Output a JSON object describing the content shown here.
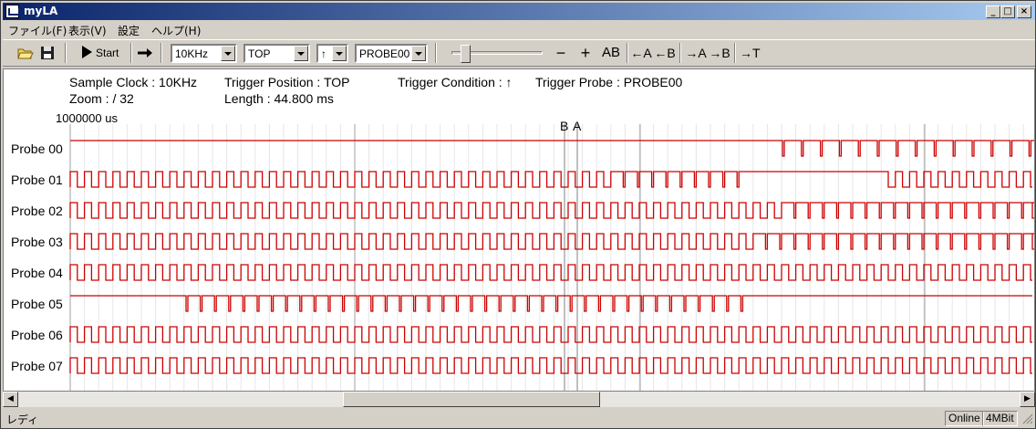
{
  "window": {
    "title": "myLA"
  },
  "menu": [
    "ファイル(F)",
    "表示(V)",
    "設定",
    "ヘルプ(H)"
  ],
  "toolbar": {
    "start_label": "Start",
    "clock_select": "10KHz",
    "position_select": "TOP",
    "condition_select": "↑",
    "probe_select": "PROBE00",
    "minus": "−",
    "plus": "+",
    "ab": "AB",
    "left_a": "←A",
    "left_b": "←B",
    "right_a": "→A",
    "right_b": "→B",
    "right_t": "→T"
  },
  "info": {
    "sample_clock": "Sample Clock : 10KHz",
    "zoom": "Zoom : /  32",
    "trigger_position": "Trigger Position : TOP",
    "length": "Length : 44.800 ms",
    "trigger_condition": "Trigger Condition :  ↑",
    "trigger_probe": "Trigger Probe : PROBE00"
  },
  "scale_label": "1000000 us",
  "cursor_labels": {
    "b": "B",
    "a": "A"
  },
  "probes": [
    "Probe 00",
    "Probe 01",
    "Probe 02",
    "Probe 03",
    "Probe 04",
    "Probe 05",
    "Probe 06",
    "Probe 07"
  ],
  "status": {
    "text": "レディ",
    "online": "Online",
    "memory": "4MBit"
  },
  "colors": {
    "signal": "#cc0000",
    "grid": "#e6e6e6",
    "cursor": "#808080"
  }
}
